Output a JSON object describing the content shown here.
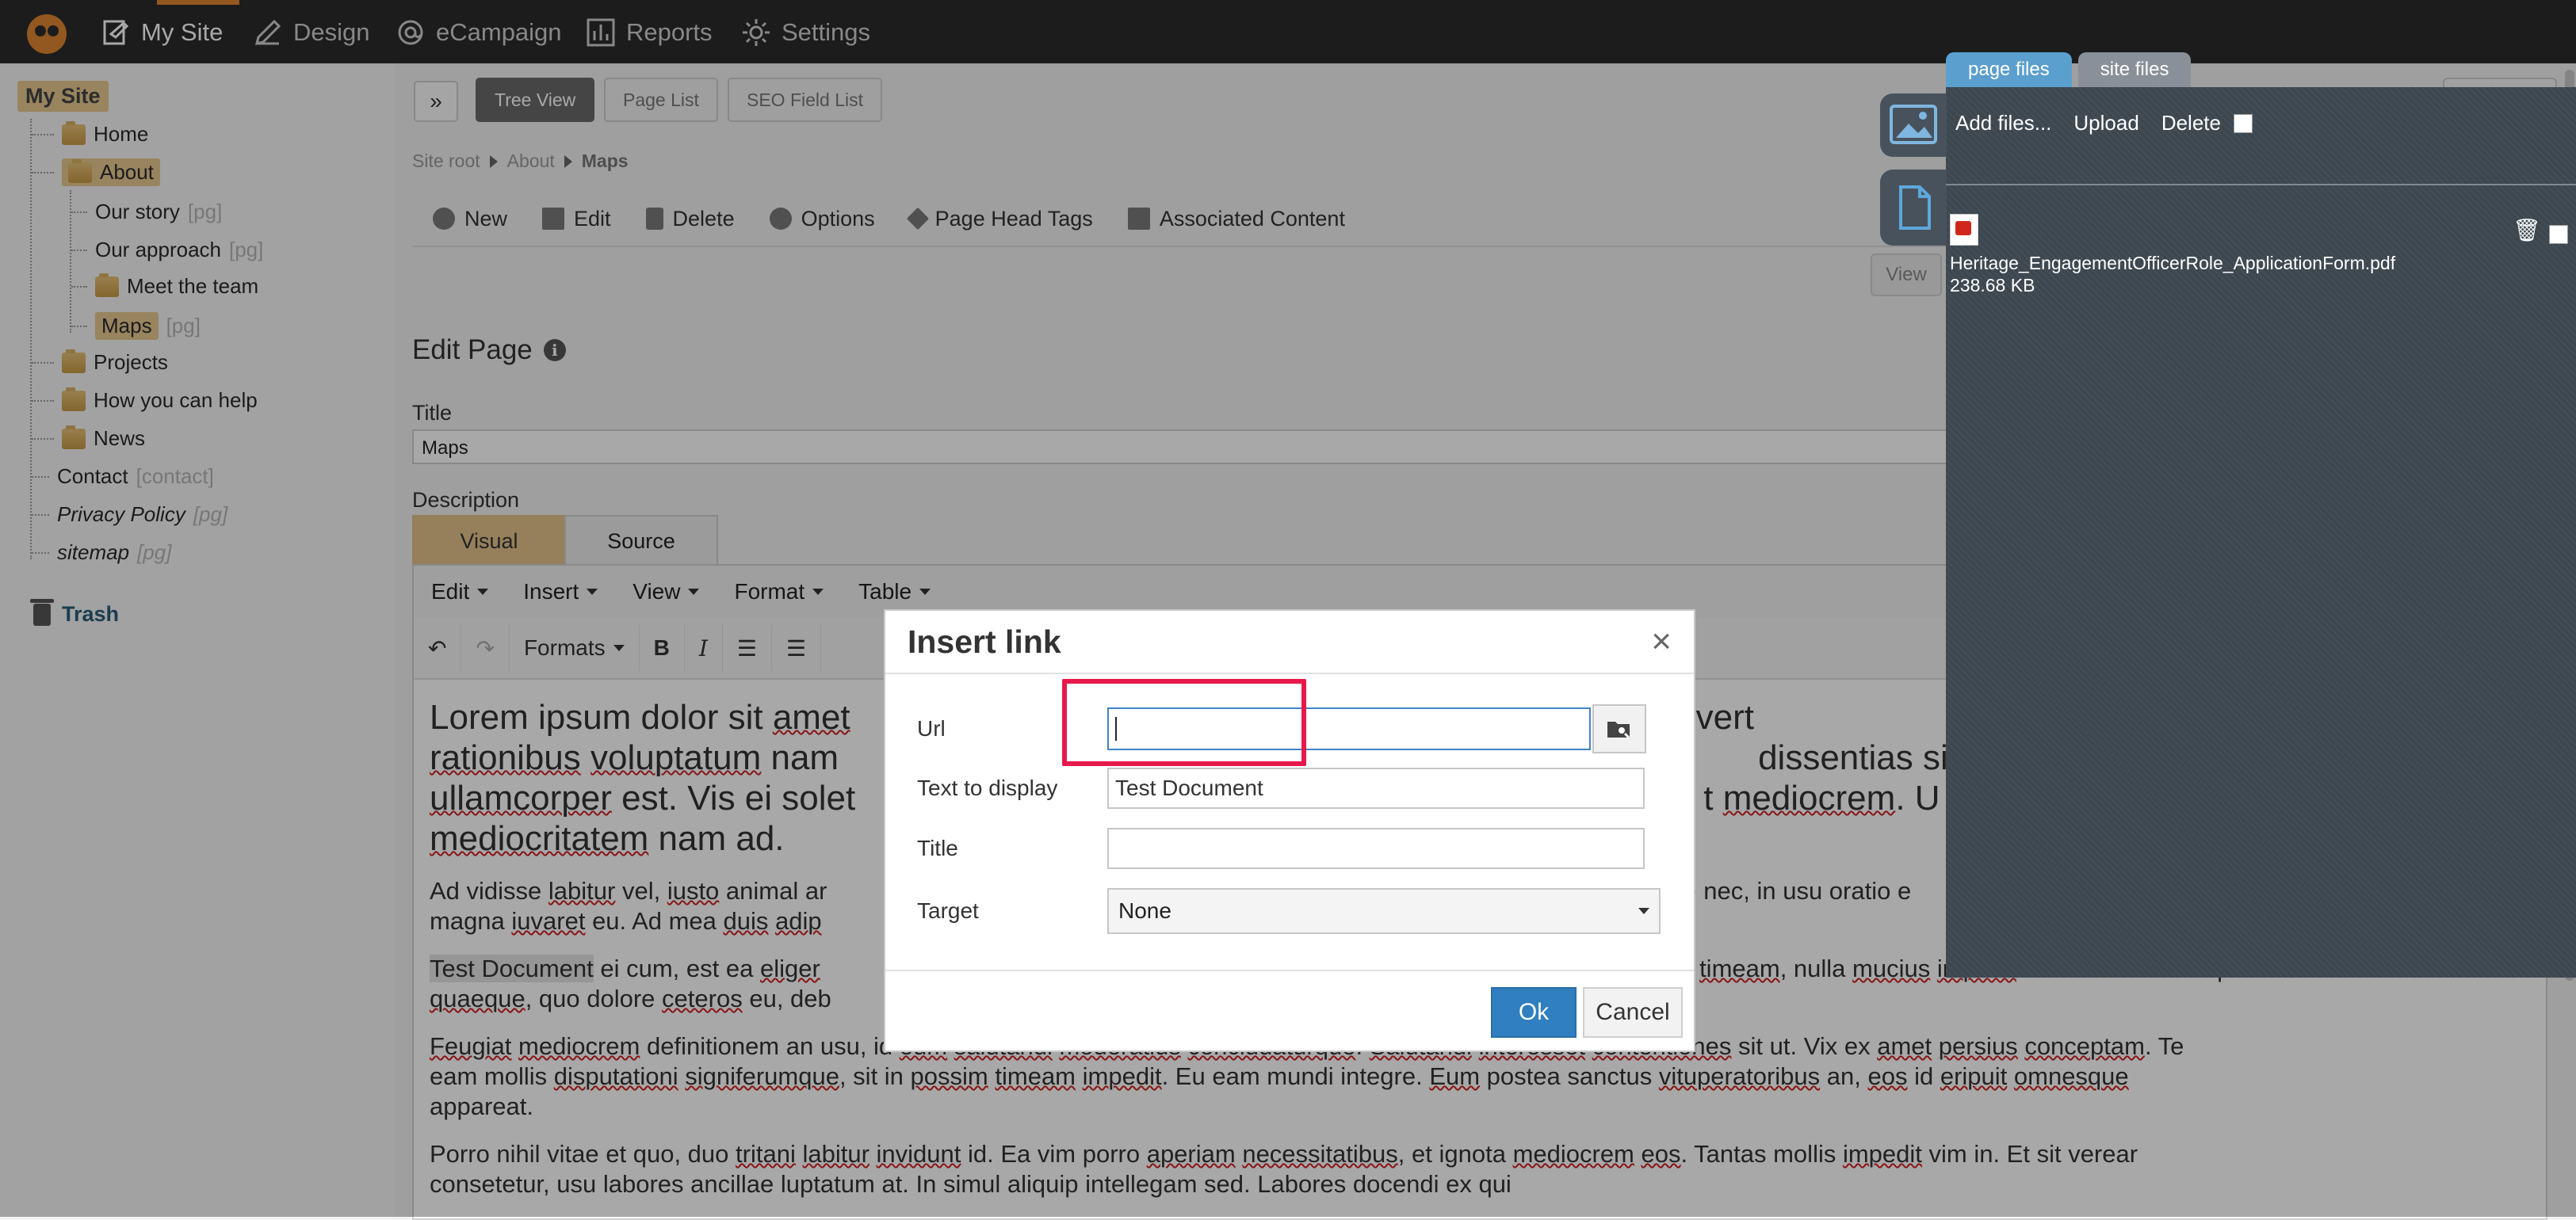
{
  "topnav": {
    "items": [
      {
        "label": "My Site",
        "icon": "page-edit-icon"
      },
      {
        "label": "Design",
        "icon": "pencil-icon"
      },
      {
        "label": "eCampaign",
        "icon": "at-icon"
      },
      {
        "label": "Reports",
        "icon": "bar-chart-icon"
      },
      {
        "label": "Settings",
        "icon": "gear-icon"
      }
    ]
  },
  "sidebar": {
    "root": "My Site",
    "items": [
      {
        "label": "Home",
        "tag": ""
      },
      {
        "label": "About",
        "tag": ""
      },
      {
        "label": "Our story",
        "tag": "[pg]"
      },
      {
        "label": "Our approach",
        "tag": "[pg]"
      },
      {
        "label": "Meet the team",
        "tag": ""
      },
      {
        "label": "Maps",
        "tag": "[pg]"
      },
      {
        "label": "Projects",
        "tag": ""
      },
      {
        "label": "How you can help",
        "tag": ""
      },
      {
        "label": "News",
        "tag": ""
      },
      {
        "label": "Contact",
        "tag": "[contact]"
      },
      {
        "label": "Privacy Policy",
        "tag": "[pg]"
      },
      {
        "label": "sitemap",
        "tag": "[pg]"
      }
    ],
    "trash": "Trash"
  },
  "viewbar": {
    "expand": "»",
    "tabs": [
      "Tree View",
      "Page List",
      "SEO Field List"
    ]
  },
  "breadcrumb": [
    "Site root",
    "About",
    "Maps"
  ],
  "actions": [
    "New",
    "Edit",
    "Delete",
    "Options",
    "Page Head Tags",
    "Associated Content"
  ],
  "view_button": "View",
  "edit": {
    "heading": "Edit Page",
    "title_label": "Title",
    "title_value": "Maps",
    "description_label": "Description",
    "editor_tabs": [
      "Visual",
      "Source"
    ],
    "menu": [
      "Edit",
      "Insert",
      "View",
      "Format",
      "Table"
    ],
    "formats_label": "Formats"
  },
  "document": {
    "p1": [
      "Lorem ipsum dolor sit ",
      "amet",
      "s ei has, id evert",
      "rationibus",
      " ",
      "voluptatum",
      " nam",
      "dissentias sit. Est",
      "ullamcorper",
      " est. Vis ei solet",
      "t",
      " ",
      "mediocrem",
      ". U",
      "mediocritatem",
      " nam ad."
    ],
    "p2": [
      "Ad vidisse ",
      "labitur",
      " vel, ",
      "iusto",
      " animal ar",
      "e nec, in usu oratio e",
      "magna ",
      "iuvaret",
      " eu. Ad mea ",
      "duis",
      " ",
      "adip"
    ],
    "p3": [
      "Test Document",
      " ei cum, est ea ",
      "eliger",
      "orem ",
      "timeam",
      ", nulla ",
      "mucius",
      " ",
      "impedit",
      " cu est. Ut his sint probo",
      "quaeque",
      ", quo dolore ",
      "ceteros",
      " eu, deb"
    ],
    "p4": [
      "Feugiat",
      " ",
      "mediocrem",
      " definitionem an usu, id ",
      "eum",
      " ",
      "salutandi",
      " ",
      "moderatius",
      " ",
      "concludaturque",
      ". ",
      "Salutandi",
      " ",
      "interesset",
      " ",
      "contentiones",
      " sit ut. Vix ex ",
      "amet",
      " ",
      "persius",
      " ",
      "conceptam",
      ". Te",
      "eam mollis ",
      "disputationi",
      " ",
      "signiferumque",
      ", sit in ",
      "possim",
      " ",
      "timeam",
      " ",
      "impedit",
      ". Eu eam mundi integre. ",
      "Eum",
      " postea sanctus ",
      "vituperatoribus",
      " an, ",
      "eos",
      " id ",
      "eripuit",
      " ",
      "omnesque",
      "appareat",
      "."
    ],
    "p5": [
      "Porro nihil vitae et quo, duo ",
      "tritani",
      " ",
      "labitur",
      " ",
      "invidunt",
      " id. Ea vim porro ",
      "aperiam",
      " ",
      "necessitatibus",
      ", et ignota ",
      "mediocrem",
      " ",
      "eos",
      ". Tantas mollis ",
      "impedit",
      " vim in. Et sit verear",
      "consetetur, usu labores ancillae luptatum at. In simul aliquip intellegam sed. Labores docendi ex qui"
    ]
  },
  "panel": {
    "tabs": [
      "page files",
      "site files"
    ],
    "add_files": "Add files...",
    "upload": "Upload",
    "delete": "Delete",
    "file_name": "Heritage_EngagementOfficerRole_ApplicationForm.pdf",
    "file_size": "238.68 KB"
  },
  "dialog": {
    "title": "Insert link",
    "close": "×",
    "url_label": "Url",
    "url_value": "",
    "text_label": "Text to display",
    "text_value": "Test Document",
    "title_label": "Title",
    "title_value": "",
    "target_label": "Target",
    "target_value": "None",
    "ok": "Ok",
    "cancel": "Cancel"
  },
  "colors": {
    "accent": "#e0862f",
    "highlight": "#e7194a",
    "primary_button": "#2f7fc1",
    "panel_bg": "#3c4750"
  }
}
